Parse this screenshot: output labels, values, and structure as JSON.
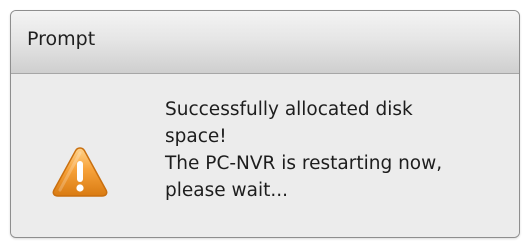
{
  "dialog": {
    "title": "Prompt",
    "icon": "warning-icon",
    "message_lines": [
      "Successfully allocated disk",
      "space!",
      "The PC-NVR is restarting now,",
      "please wait..."
    ]
  },
  "colors": {
    "title_bar_top": "#f4f4f4",
    "title_bar_bottom": "#cfcfcf",
    "body_background": "#ececec",
    "warning_orange": "#f39a1f"
  }
}
